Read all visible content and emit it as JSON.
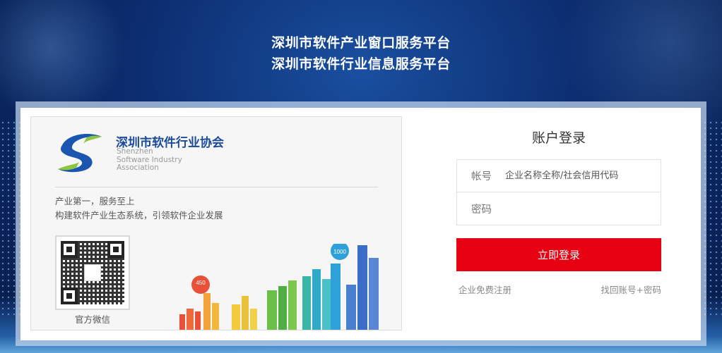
{
  "header": {
    "title_line1": "深圳市软件产业窗口服务平台",
    "title_line2": "深圳市软件行业信息服务平台"
  },
  "association": {
    "name_cn": "深圳市软件行业协会",
    "name_en_1": "Shenzhen",
    "name_en_2": "Software Industry",
    "name_en_3": "Association",
    "slogan_1": "产业第一，服务至上",
    "slogan_2": "构建软件产业生态系统，引领软件企业发展",
    "qr_label": "官方微信",
    "logo_colors": [
      "#1a55b0",
      "#8cc63f"
    ]
  },
  "city_badges": {
    "badge_1": "1000",
    "badge_2": "450"
  },
  "login": {
    "title": "账户登录",
    "account_label": "帐号",
    "account_placeholder": "企业名称全称/社会信用代码",
    "password_label": "密码",
    "password_placeholder": "",
    "submit_label": "立即登录",
    "register_link": "企业免费注册",
    "forgot_link": "找回账号+密码",
    "accent_color": "#e60012"
  }
}
